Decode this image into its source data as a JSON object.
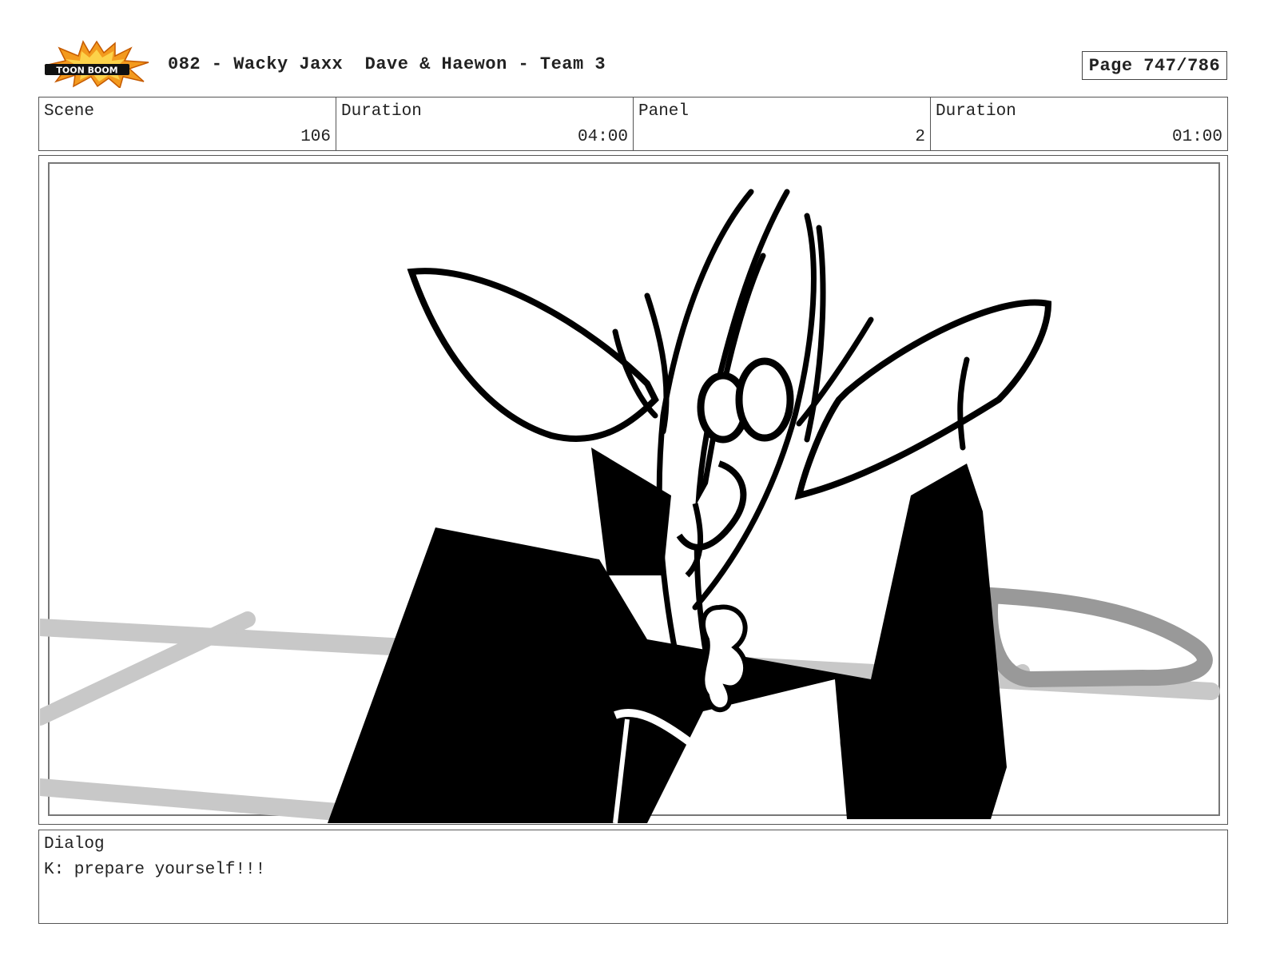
{
  "header": {
    "logo_icon": "toon-boom-logo",
    "logo_text": "TOON BOOM",
    "title": "082 - Wacky Jaxx  Dave & Haewon - Team 3",
    "page": "Page 747/786"
  },
  "info": {
    "scene_label": "Scene",
    "scene_value": "106",
    "scene_duration_label": "Duration",
    "scene_duration_value": "04:00",
    "panel_label": "Panel",
    "panel_value": "2",
    "panel_duration_label": "Duration",
    "panel_duration_value": "01:00"
  },
  "panel": {
    "art_icon": "storyboard-sketch-character"
  },
  "dialog": {
    "label": "Dialog",
    "text": "K: prepare yourself!!!"
  }
}
